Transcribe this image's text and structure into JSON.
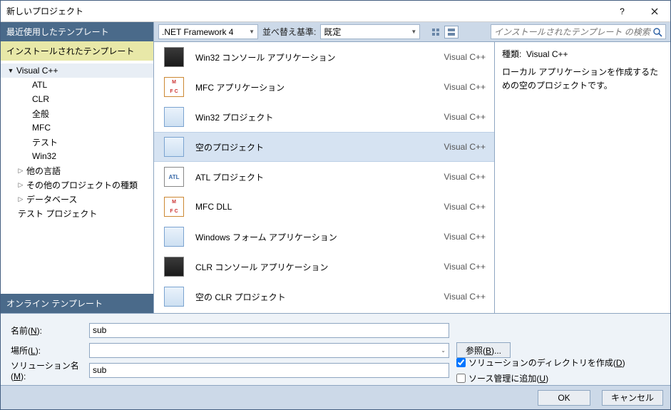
{
  "titlebar": {
    "title": "新しいプロジェクト"
  },
  "sidebar": {
    "cap_recent": "最近使用したテンプレート",
    "cap_installed": "インストールされたテンプレート",
    "cap_online": "オンライン テンプレート",
    "tree": {
      "vcpp": "Visual C++",
      "atl": "ATL",
      "clr": "CLR",
      "general": "全般",
      "mfc": "MFC",
      "test": "テスト",
      "win32": "Win32",
      "other_lang": "他の言語",
      "other_proj": "その他のプロジェクトの種類",
      "database": "データベース",
      "test_proj": "テスト プロジェクト"
    }
  },
  "toolbar": {
    "framework": ".NET Framework 4",
    "sort_label": "並べ替え基準:",
    "sort_value": "既定",
    "search_placeholder": "インストールされたテンプレート の検索"
  },
  "list": [
    {
      "name": "Win32 コンソール アプリケーション",
      "lang": "Visual C++",
      "icon": "win"
    },
    {
      "name": "MFC アプリケーション",
      "lang": "Visual C++",
      "icon": "mfc"
    },
    {
      "name": "Win32 プロジェクト",
      "lang": "Visual C++",
      "icon": "generic"
    },
    {
      "name": "空のプロジェクト",
      "lang": "Visual C++",
      "icon": "generic",
      "selected": true
    },
    {
      "name": "ATL プロジェクト",
      "lang": "Visual C++",
      "icon": "atl"
    },
    {
      "name": "MFC DLL",
      "lang": "Visual C++",
      "icon": "mfc"
    },
    {
      "name": "Windows フォーム アプリケーション",
      "lang": "Visual C++",
      "icon": "generic"
    },
    {
      "name": "CLR コンソール アプリケーション",
      "lang": "Visual C++",
      "icon": "win"
    },
    {
      "name": "空の CLR プロジェクト",
      "lang": "Visual C++",
      "icon": "generic"
    }
  ],
  "details": {
    "type_label": "種類:",
    "type_value": "Visual C++",
    "description": "ローカル アプリケーションを作成するための空のプロジェクトです。"
  },
  "form": {
    "name_label": "名前(N):",
    "name_value": "sub",
    "location_label": "場所(L):",
    "location_value": "",
    "solution_label": "ソリューション名(M):",
    "solution_value": "sub",
    "browse": "参照(B)...",
    "create_dir": "ソリューションのディレクトリを作成(D)",
    "source_control": "ソース管理に追加(U)"
  },
  "footer": {
    "ok": "OK",
    "cancel": "キャンセル"
  }
}
